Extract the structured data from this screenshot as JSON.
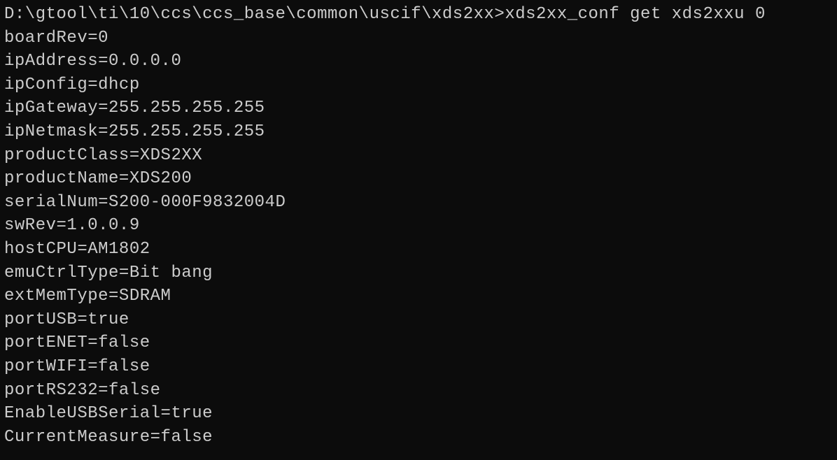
{
  "terminal": {
    "prompt": "D:\\gtool\\ti\\10\\ccs\\ccs_base\\common\\uscif\\xds2xx>",
    "command": "xds2xx_conf get xds2xxu 0",
    "output": [
      "boardRev=0",
      "ipAddress=0.0.0.0",
      "ipConfig=dhcp",
      "ipGateway=255.255.255.255",
      "ipNetmask=255.255.255.255",
      "productClass=XDS2XX",
      "productName=XDS200",
      "serialNum=S200-000F9832004D",
      "swRev=1.0.0.9",
      "hostCPU=AM1802",
      "emuCtrlType=Bit bang",
      "extMemType=SDRAM",
      "portUSB=true",
      "portENET=false",
      "portWIFI=false",
      "portRS232=false",
      "EnableUSBSerial=true",
      "CurrentMeasure=false"
    ]
  }
}
